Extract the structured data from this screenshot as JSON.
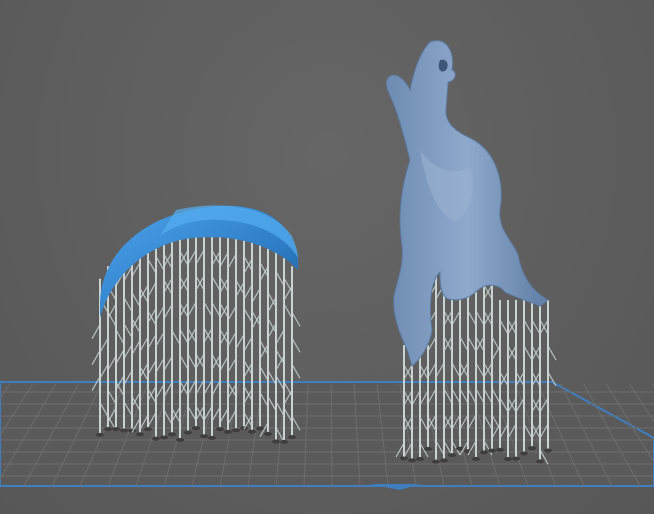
{
  "scene": {
    "type": "3d-viewport",
    "background_color": "#5f5f5f",
    "build_plate": {
      "grid_color": "#6b6b6b",
      "border_color": "#3f7fc0"
    },
    "objects": [
      {
        "name": "disc-part",
        "color": "#3c8ad6",
        "supports": "tree"
      },
      {
        "name": "wolf-figure",
        "color": "#7a9ac0",
        "supports": "tree"
      }
    ],
    "support_color": "#c9d4d2"
  }
}
